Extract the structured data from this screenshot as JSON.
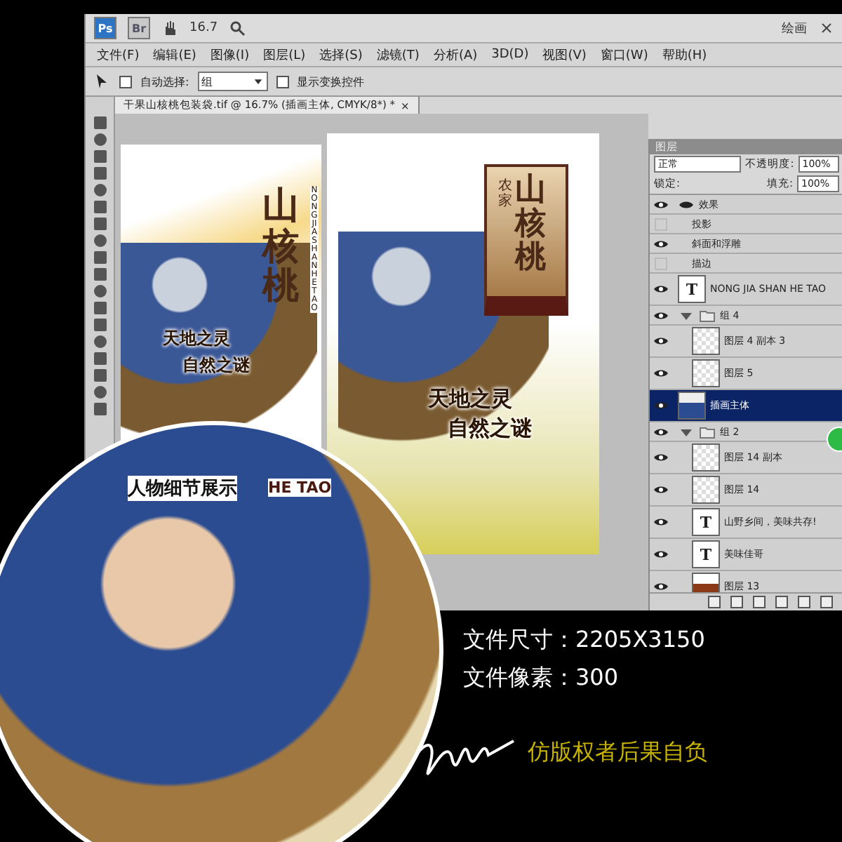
{
  "app_bar": {
    "ps_logo": "Ps",
    "br_logo": "Br",
    "zoom": "16.7",
    "workspace": "绘画"
  },
  "menu": [
    "文件(F)",
    "编辑(E)",
    "图像(I)",
    "图层(L)",
    "选择(S)",
    "滤镜(T)",
    "分析(A)",
    "3D(D)",
    "视图(V)",
    "窗口(W)",
    "帮助(H)"
  ],
  "options": {
    "auto_select": {
      "label": "自动选择:",
      "checked": false
    },
    "auto_select_value": "组",
    "transform": {
      "label": "显示变换控件",
      "checked": false
    }
  },
  "document_tab": {
    "title": "干果山核桃包装袋.tif @ 16.7% (插画主体, CMYK/8*) *",
    "close": "×"
  },
  "artboards": [
    {
      "kind": "back",
      "title": "山核桃",
      "pinyin": "NONG JIA SHAN HE TAO",
      "slogan": [
        "天地之灵",
        "自然之谜"
      ]
    },
    {
      "kind": "front",
      "prefix": "农家",
      "title": "山核桃",
      "slogan": [
        "天地之灵",
        "自然之谜"
      ]
    }
  ],
  "layers_panel": {
    "tab": "图层",
    "blend_mode": "正常",
    "opacity_label": "不透明度:",
    "opacity": "100%",
    "lock_label": "锁定:",
    "fill_label": "填充:",
    "fill": "100%",
    "layers": [
      {
        "kind": "effects",
        "name": "效果",
        "visible": true,
        "selected": false,
        "children": [
          {
            "kind": "effect",
            "name": "投影",
            "visible": false,
            "selected": false
          },
          {
            "kind": "effect",
            "name": "斜面和浮雕",
            "visible": true,
            "selected": false
          },
          {
            "kind": "effect",
            "name": "描边",
            "visible": false,
            "selected": false
          }
        ]
      },
      {
        "kind": "text",
        "thumbnail": "T",
        "name": "NONG JIA SHAN HE TAO",
        "visible": true,
        "selected": false
      },
      {
        "kind": "group",
        "name": "组 4",
        "visible": true,
        "selected": false,
        "expanded": true,
        "children": [
          {
            "kind": "layer",
            "name": "图层 4 副本 3",
            "visible": true,
            "selected": false
          },
          {
            "kind": "layer",
            "name": "图层 5",
            "visible": true,
            "selected": false
          }
        ]
      },
      {
        "kind": "image",
        "name": "插画主体",
        "visible": true,
        "selected": true
      },
      {
        "kind": "group",
        "name": "组 2",
        "visible": true,
        "selected": false,
        "expanded": true,
        "children": [
          {
            "kind": "layer",
            "name": "图层 14 副本",
            "visible": true,
            "selected": false
          },
          {
            "kind": "layer",
            "name": "图层 14",
            "visible": true,
            "selected": false
          },
          {
            "kind": "text",
            "thumbnail": "T",
            "name": "山野乡间，美味共存!",
            "visible": true,
            "selected": false
          },
          {
            "kind": "text",
            "thumbnail": "T",
            "name": "美味佳哥",
            "visible": true,
            "selected": false
          },
          {
            "kind": "swatch",
            "name": "图层 13",
            "visible": true,
            "selected": false
          }
        ]
      }
    ]
  },
  "detail": {
    "caption": "人物细节展示",
    "side_text": "HE TAO"
  },
  "info": {
    "lines": [
      "文件尺寸：2205X3150",
      "文件像素：300"
    ],
    "notice": "仿版权者后果自负"
  }
}
